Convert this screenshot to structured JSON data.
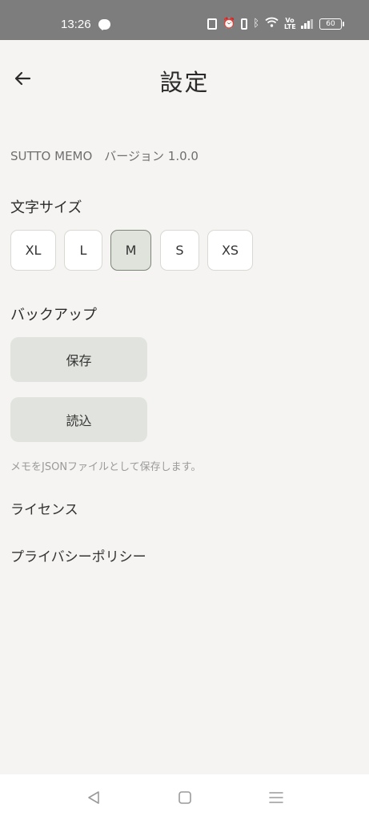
{
  "status_bar": {
    "time": "13:26",
    "battery": "60",
    "volte": "Vo\nLTE"
  },
  "header": {
    "title": "設定"
  },
  "app_info": {
    "version_text": "SUTTO MEMO　バージョン 1.0.0"
  },
  "font_size": {
    "title": "文字サイズ",
    "options": [
      "XL",
      "L",
      "M",
      "S",
      "XS"
    ],
    "selected": "M"
  },
  "backup": {
    "title": "バックアップ",
    "save_label": "保存",
    "load_label": "読込",
    "note": "メモをJSONファイルとして保存します。"
  },
  "links": {
    "license": "ライセンス",
    "privacy": "プライバシーポリシー"
  },
  "colors": {
    "background": "#f5f4f2",
    "status_bar": "#7d7d7d",
    "selected_option": "#e0e3dc",
    "button_bg": "#e1e4de"
  }
}
